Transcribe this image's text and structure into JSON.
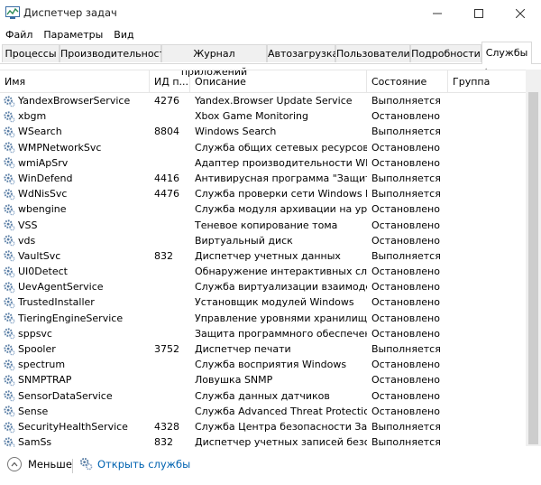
{
  "window": {
    "title": "Диспетчер задач"
  },
  "menu": [
    "Файл",
    "Параметры",
    "Вид"
  ],
  "tabs": [
    {
      "label": "Процессы"
    },
    {
      "label": "Производительность"
    },
    {
      "label": "Журнал приложений"
    },
    {
      "label": "Автозагрузка"
    },
    {
      "label": "Пользователи"
    },
    {
      "label": "Подробности"
    },
    {
      "label": "Службы"
    }
  ],
  "active_tab": "Службы",
  "columns": {
    "name": "Имя",
    "pid": "ИД п...",
    "desc": "Описание",
    "state": "Состояние",
    "group": "Группа"
  },
  "rows": [
    {
      "name": "YandexBrowserService",
      "pid": "4276",
      "desc": "Yandex.Browser Update Service",
      "state": "Выполняется"
    },
    {
      "name": "xbgm",
      "pid": "",
      "desc": "Xbox Game Monitoring",
      "state": "Остановлено"
    },
    {
      "name": "WSearch",
      "pid": "8804",
      "desc": "Windows Search",
      "state": "Выполняется"
    },
    {
      "name": "WMPNetworkSvc",
      "pid": "",
      "desc": "Служба общих сетевых ресурсов п...",
      "state": "Остановлено"
    },
    {
      "name": "wmiApSrv",
      "pid": "",
      "desc": "Адаптер производительности WMI",
      "state": "Остановлено"
    },
    {
      "name": "WinDefend",
      "pid": "4416",
      "desc": "Антивирусная программа \"Защит...",
      "state": "Выполняется"
    },
    {
      "name": "WdNisSvc",
      "pid": "4476",
      "desc": "Служба проверки сети Windows D...",
      "state": "Выполняется"
    },
    {
      "name": "wbengine",
      "pid": "",
      "desc": "Служба модуля архивации на уров...",
      "state": "Остановлено"
    },
    {
      "name": "VSS",
      "pid": "",
      "desc": "Теневое копирование тома",
      "state": "Остановлено"
    },
    {
      "name": "vds",
      "pid": "",
      "desc": "Виртуальный диск",
      "state": "Остановлено"
    },
    {
      "name": "VaultSvc",
      "pid": "832",
      "desc": "Диспетчер учетных данных",
      "state": "Выполняется"
    },
    {
      "name": "UI0Detect",
      "pid": "",
      "desc": "Обнаружение интерактивных служб",
      "state": "Остановлено"
    },
    {
      "name": "UevAgentService",
      "pid": "",
      "desc": "Служба виртуализации взаимодей...",
      "state": "Остановлено"
    },
    {
      "name": "TrustedInstaller",
      "pid": "",
      "desc": "Установщик модулей Windows",
      "state": "Остановлено"
    },
    {
      "name": "TieringEngineService",
      "pid": "",
      "desc": "Управление уровнями хранилища",
      "state": "Остановлено"
    },
    {
      "name": "sppsvc",
      "pid": "",
      "desc": "Защита программного обеспечен...",
      "state": "Остановлено"
    },
    {
      "name": "Spooler",
      "pid": "3752",
      "desc": "Диспетчер печати",
      "state": "Выполняется"
    },
    {
      "name": "spectrum",
      "pid": "",
      "desc": "Служба восприятия Windows",
      "state": "Остановлено"
    },
    {
      "name": "SNMPTRAP",
      "pid": "",
      "desc": "Ловушка SNMP",
      "state": "Остановлено"
    },
    {
      "name": "SensorDataService",
      "pid": "",
      "desc": "Служба данных датчиков",
      "state": "Остановлено"
    },
    {
      "name": "Sense",
      "pid": "",
      "desc": "Служба Advanced Threat Protectio...",
      "state": "Остановлено"
    },
    {
      "name": "SecurityHealthService",
      "pid": "4328",
      "desc": "Служба Центра безопасности Защ...",
      "state": "Выполняется"
    },
    {
      "name": "SamSs",
      "pid": "832",
      "desc": "Диспетчер учетных записей безоп...",
      "state": "Выполняется"
    }
  ],
  "footer": {
    "less": "Меньше",
    "open_services": "Открыть службы"
  },
  "colors": {
    "link": "#0063b1",
    "gear": "#5b7fa6"
  }
}
